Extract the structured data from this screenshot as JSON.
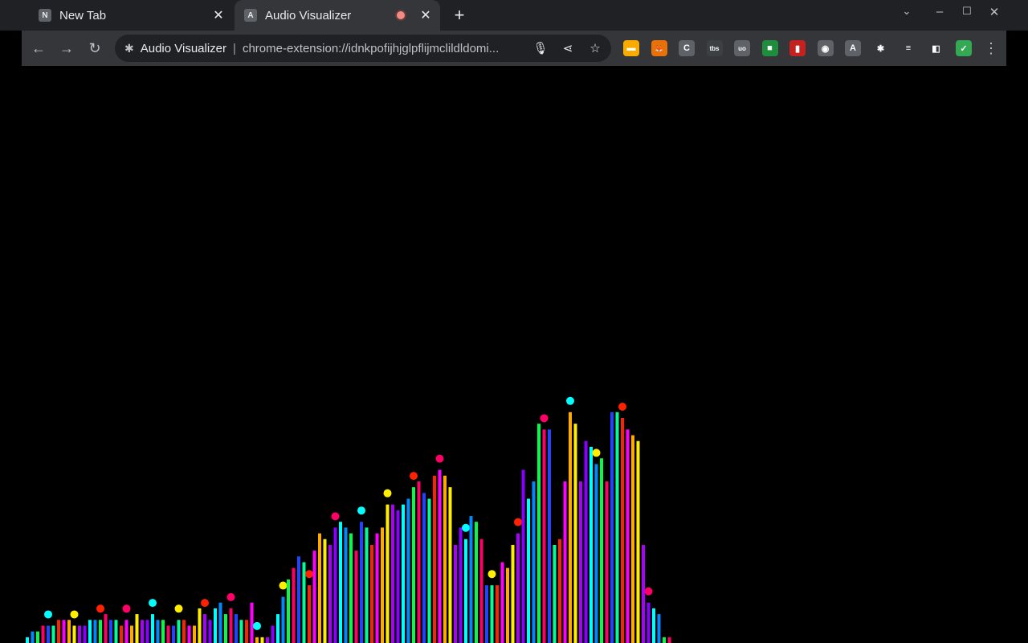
{
  "tabs": [
    {
      "label": "New Tab",
      "favicon": "N",
      "active": false
    },
    {
      "label": "Audio Visualizer",
      "favicon": "A",
      "active": true,
      "recording": true
    }
  ],
  "omnibox": {
    "site": "Audio Visualizer",
    "url": "chrome-extension://idnkpofijhjglpflijmclildldomi..."
  },
  "extensions": [
    {
      "name": "bar-extension-icon",
      "glyph": "▬",
      "color": "#f9ab00"
    },
    {
      "name": "fox-extension-icon",
      "glyph": "🦊",
      "color": "#e8710a"
    },
    {
      "name": "css-extension-icon",
      "glyph": "C",
      "color": "#5f6368"
    },
    {
      "name": "tbs-extension-icon",
      "glyph": "tbs",
      "color": "#3c4043"
    },
    {
      "name": "ublock-extension-icon",
      "glyph": "uo",
      "color": "#5f6368"
    },
    {
      "name": "color-extension-icon",
      "glyph": "■",
      "color": "#1e8e3e"
    },
    {
      "name": "audio-bars-extension-icon",
      "glyph": "▮",
      "color": "#c5221f"
    },
    {
      "name": "spy-extension-icon",
      "glyph": "◉",
      "color": "#5f6368"
    },
    {
      "name": "translate-extension-icon",
      "glyph": "A",
      "color": "#5f6368"
    },
    {
      "name": "puzzle-extension-icon",
      "glyph": "✱",
      "color": "#35363a"
    },
    {
      "name": "media-extension-icon",
      "glyph": "≡",
      "color": "#35363a"
    },
    {
      "name": "sidepanel-extension-icon",
      "glyph": "◧",
      "color": "#35363a"
    },
    {
      "name": "profile-extension-icon",
      "glyph": "✓",
      "color": "#34a853"
    }
  ],
  "visualizer": {
    "palette": [
      "#00ffff",
      "#ff00ff",
      "#00ff44",
      "#ffee00",
      "#2244ff",
      "#8800ff",
      "#ff2200",
      "#0088ff",
      "#ffaa00",
      "#ff0066",
      "#aa00ff",
      "#00ff99"
    ],
    "levels": [
      0.01,
      0.02,
      0.02,
      0.03,
      0.03,
      0.03,
      0.04,
      0.04,
      0.04,
      0.03,
      0.03,
      0.03,
      0.04,
      0.04,
      0.04,
      0.05,
      0.04,
      0.04,
      0.03,
      0.04,
      0.03,
      0.05,
      0.04,
      0.04,
      0.05,
      0.04,
      0.04,
      0.03,
      0.03,
      0.04,
      0.04,
      0.03,
      0.03,
      0.06,
      0.05,
      0.04,
      0.06,
      0.07,
      0.05,
      0.06,
      0.05,
      0.04,
      0.04,
      0.07,
      0.01,
      0.01,
      0.01,
      0.03,
      0.05,
      0.08,
      0.11,
      0.13,
      0.15,
      0.14,
      0.1,
      0.16,
      0.19,
      0.18,
      0.17,
      0.2,
      0.21,
      0.2,
      0.19,
      0.16,
      0.21,
      0.2,
      0.17,
      0.19,
      0.2,
      0.24,
      0.24,
      0.23,
      0.24,
      0.25,
      0.27,
      0.28,
      0.26,
      0.25,
      0.29,
      0.3,
      0.29,
      0.27,
      0.17,
      0.2,
      0.18,
      0.22,
      0.21,
      0.18,
      0.1,
      0.1,
      0.1,
      0.14,
      0.13,
      0.17,
      0.19,
      0.3,
      0.25,
      0.28,
      0.38,
      0.37,
      0.37,
      0.17,
      0.18,
      0.28,
      0.4,
      0.38,
      0.28,
      0.35,
      0.34,
      0.31,
      0.32,
      0.28,
      0.4,
      0.4,
      0.39,
      0.37,
      0.36,
      0.35,
      0.17,
      0.07,
      0.06,
      0.05,
      0.01,
      0.01
    ]
  }
}
